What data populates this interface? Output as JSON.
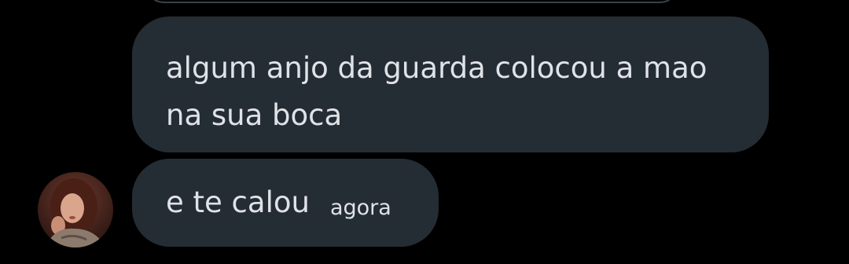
{
  "conversation": {
    "messages": [
      {
        "text": "algum anjo da guarda colocou a mao na sua boca"
      },
      {
        "text": "e te calou",
        "timestamp": "agora"
      }
    ]
  },
  "colors": {
    "background": "#000000",
    "bubble": "#252d34",
    "text": "#dfe3e7"
  }
}
